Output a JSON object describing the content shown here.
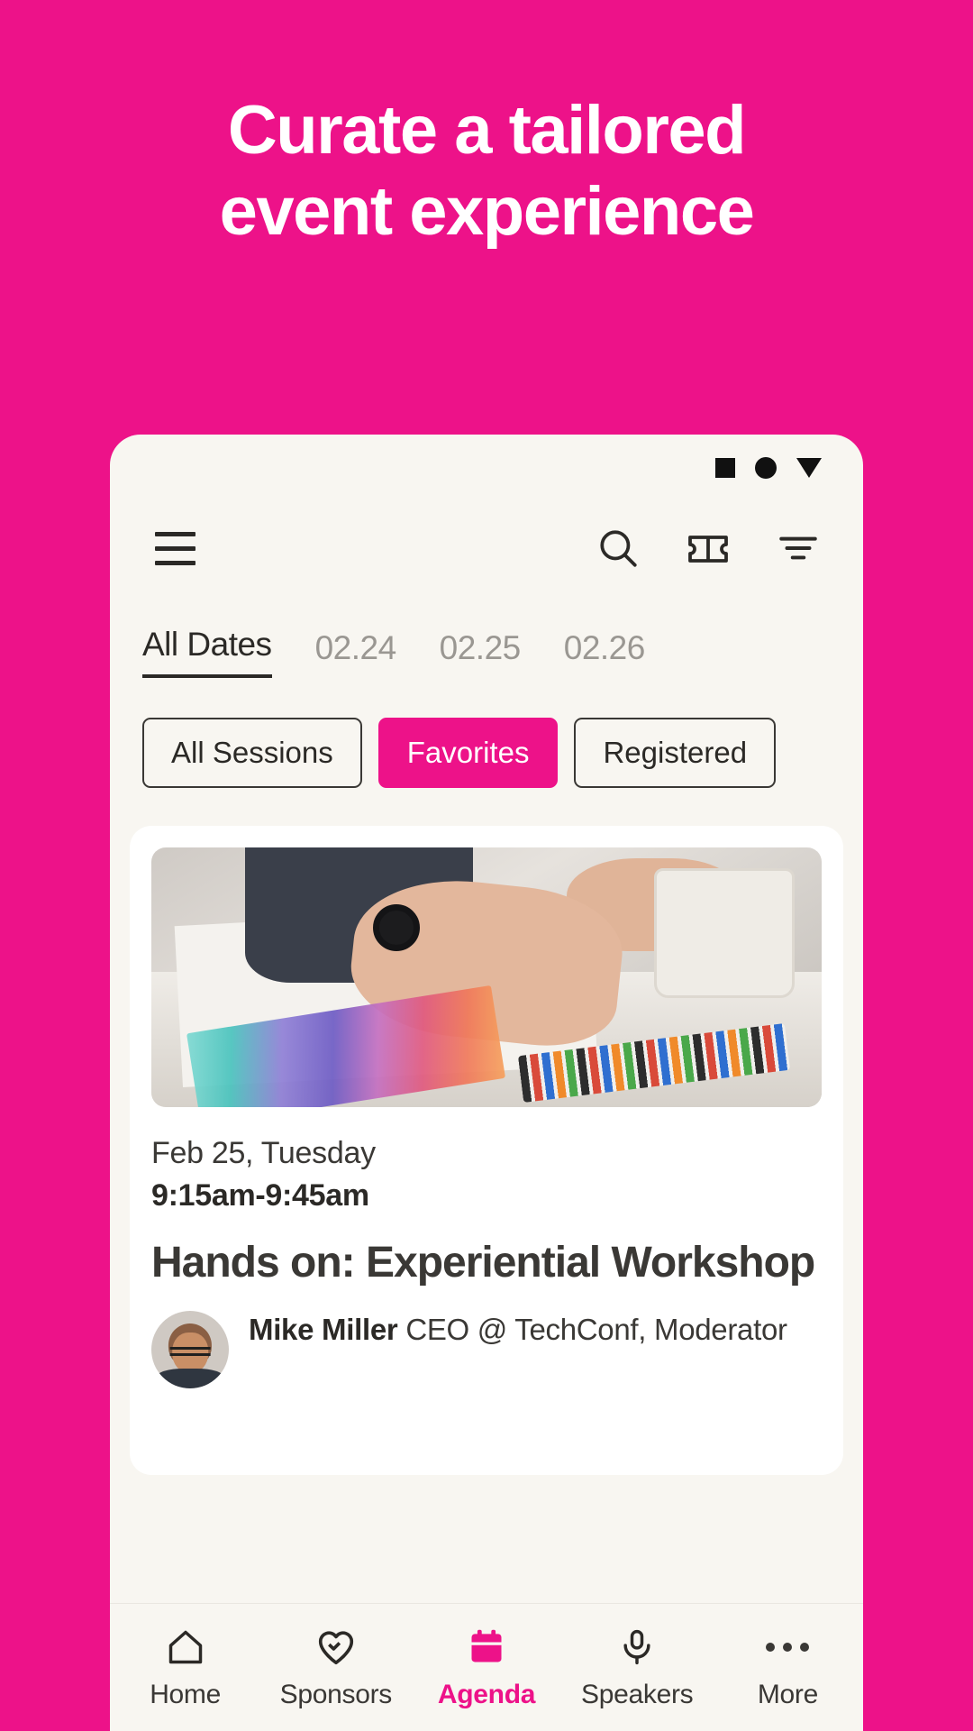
{
  "theme": {
    "brand_pink": "#ED1289",
    "surface": "#F8F6F1",
    "card": "#FFFFFF",
    "ink": "#2B2926",
    "muted": "#9A9792"
  },
  "hero": {
    "line1": "Curate a tailored",
    "line2": "event experience"
  },
  "status_bar": {
    "square_icon": "square-icon",
    "circle_icon": "circle-icon",
    "triangle_icon": "triangle-down-icon"
  },
  "appbar": {
    "menu_icon": "hamburger-menu-icon",
    "search_icon": "search-icon",
    "ticket_icon": "ticket-icon",
    "filter_icon": "filter-icon"
  },
  "date_tabs": [
    {
      "label": "All Dates",
      "active": true
    },
    {
      "label": "02.24",
      "active": false
    },
    {
      "label": "02.25",
      "active": false
    },
    {
      "label": "02.26",
      "active": false
    }
  ],
  "filter_chips": [
    {
      "label": "All Sessions",
      "active": false
    },
    {
      "label": "Favorites",
      "active": true
    },
    {
      "label": "Registered",
      "active": false
    }
  ],
  "session_card": {
    "photo_alt": "workshop-photo",
    "date": "Feb 25, Tuesday",
    "time": "9:15am-9:45am",
    "title": "Hands on: Experiential Workshop",
    "speaker": {
      "name": "Mike Miller",
      "role": "CEO @ TechConf, Moderator"
    }
  },
  "bottom_nav": [
    {
      "label": "Home",
      "icon": "home-icon",
      "active": false
    },
    {
      "label": "Sponsors",
      "icon": "heart-icon",
      "active": false
    },
    {
      "label": "Agenda",
      "icon": "calendar-icon",
      "active": true
    },
    {
      "label": "Speakers",
      "icon": "microphone-icon",
      "active": false
    },
    {
      "label": "More",
      "icon": "ellipsis-icon",
      "active": false
    }
  ]
}
